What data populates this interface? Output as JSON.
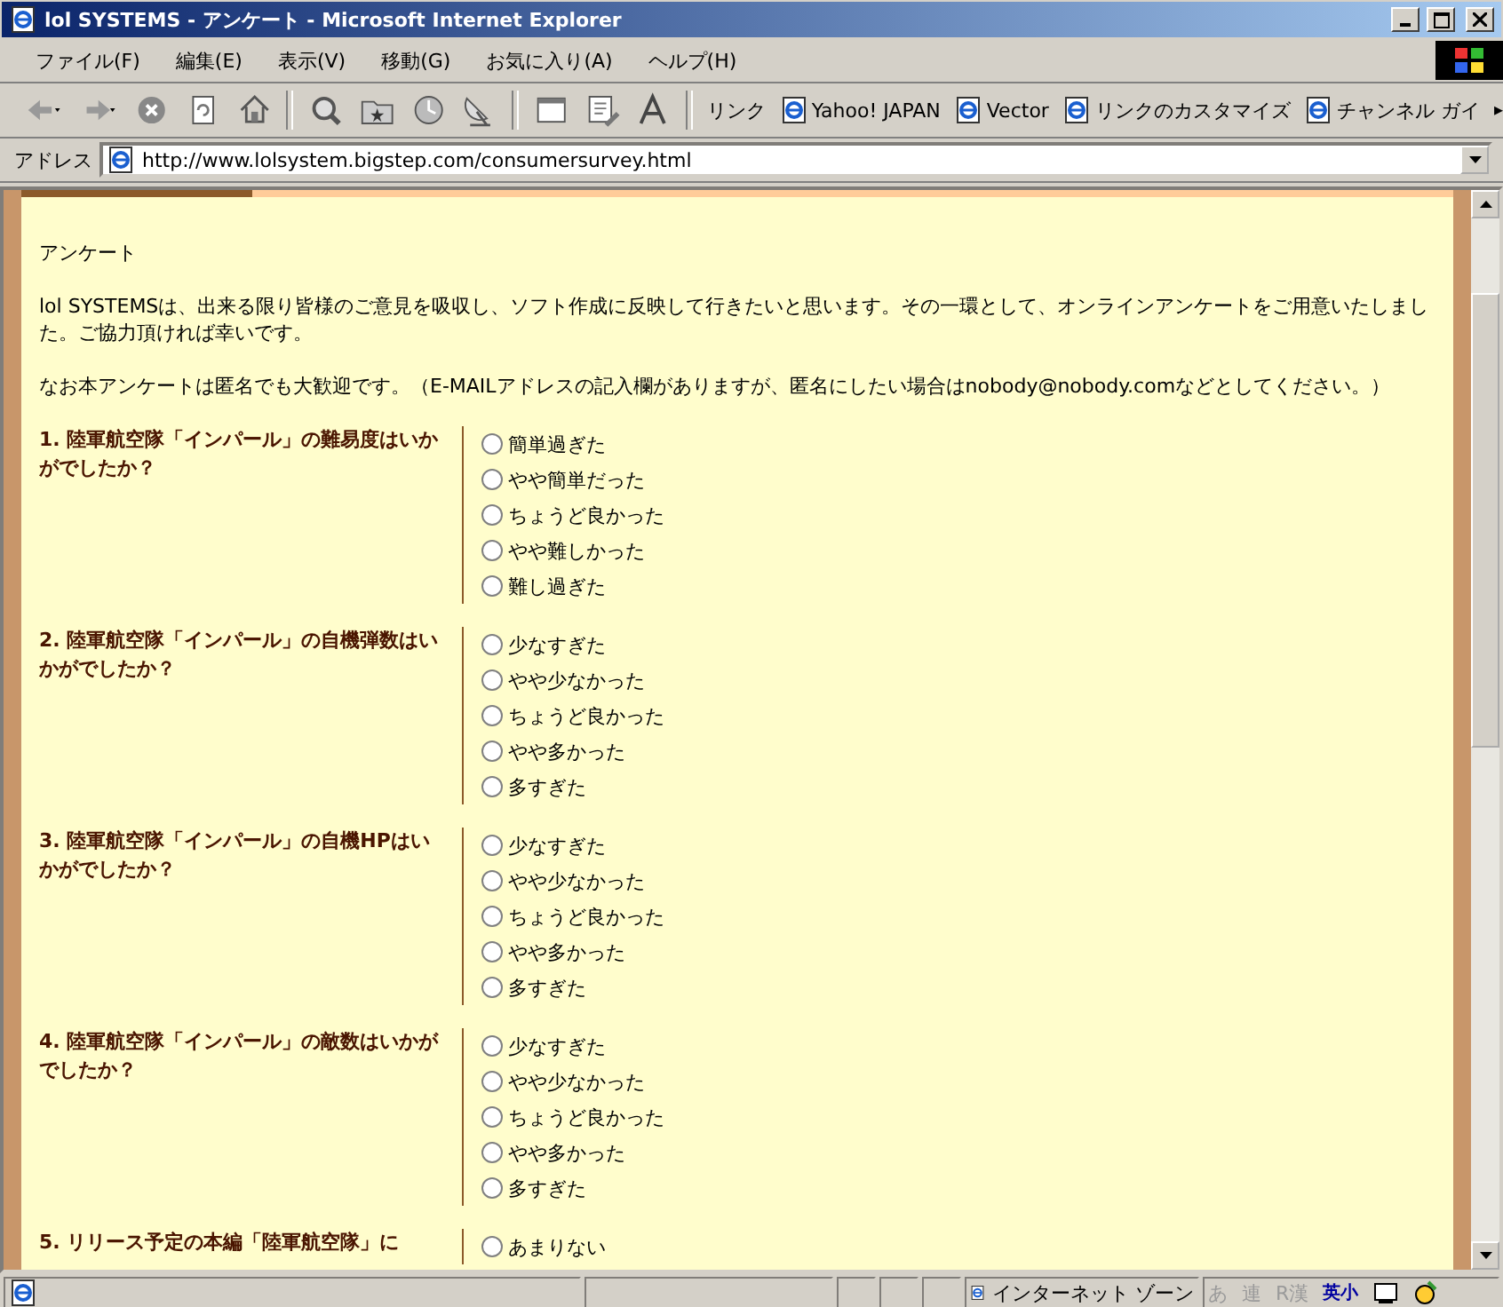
{
  "window": {
    "title": "lol SYSTEMS - アンケート - Microsoft Internet Explorer"
  },
  "menu": [
    "ファイル(F)",
    "編集(E)",
    "表示(V)",
    "移動(G)",
    "お気に入り(A)",
    "ヘルプ(H)"
  ],
  "links": {
    "label": "リンク",
    "items": [
      "Yahoo!  JAPAN",
      "Vector",
      "リンクのカスタマイズ",
      "チャンネル ガイ"
    ],
    "more": "▸"
  },
  "address": {
    "label": "アドレス",
    "value": "http://www.lolsystem.bigstep.com/consumersurvey.html"
  },
  "page": {
    "heading": "アンケート",
    "intro": "lol SYSTEMSは、出来る限り皆様のご意見を吸収し、ソフト作成に反映して行きたいと思います。その一環として、オンラインアンケートをご用意いたしました。ご協力頂ければ幸いです。",
    "note": "なお本アンケートは匿名でも大歓迎です。（E-MAILアドレスの記入欄がありますが、匿名にしたい場合はnobody@nobody.comなどとしてください。）",
    "questions": [
      {
        "text": "1. 陸軍航空隊「インパール」の難易度はいかがでしたか？",
        "options": [
          {
            "label": "簡単過ぎた",
            "selected": false
          },
          {
            "label": "やや簡単だった",
            "selected": false
          },
          {
            "label": "ちょうど良かった",
            "selected": false
          },
          {
            "label": "やや難しかった",
            "selected": false
          },
          {
            "label": "難し過ぎた",
            "selected": false
          }
        ]
      },
      {
        "text": "2. 陸軍航空隊「インパール」の自機弾数はいかがでしたか？",
        "options": [
          {
            "label": "少なすぎた",
            "selected": false
          },
          {
            "label": "やや少なかった",
            "selected": false
          },
          {
            "label": "ちょうど良かった",
            "selected": false
          },
          {
            "label": "やや多かった",
            "selected": false
          },
          {
            "label": "多すぎた",
            "selected": false
          }
        ]
      },
      {
        "text": "3. 陸軍航空隊「インパール」の自機HPはいかがでしたか？",
        "options": [
          {
            "label": "少なすぎた",
            "selected": false
          },
          {
            "label": "やや少なかった",
            "selected": false
          },
          {
            "label": "ちょうど良かった",
            "selected": false
          },
          {
            "label": "やや多かった",
            "selected": false
          },
          {
            "label": "多すぎた",
            "selected": false
          }
        ]
      },
      {
        "text": "4. 陸軍航空隊「インパール」の敵数はいかがでしたか？",
        "options": [
          {
            "label": "少なすぎた",
            "selected": false
          },
          {
            "label": "やや少なかった",
            "selected": false
          },
          {
            "label": "ちょうど良かった",
            "selected": false
          },
          {
            "label": "やや多かった",
            "selected": false
          },
          {
            "label": "多すぎた",
            "selected": false
          }
        ]
      },
      {
        "text": "5. リリース予定の本編「陸軍航空隊」に",
        "options": [
          {
            "label": "あまりない",
            "selected": false
          }
        ]
      }
    ]
  },
  "status_bar": {
    "zone": "インターネット ゾーン",
    "ime": [
      {
        "label": "あ",
        "disabled": true
      },
      {
        "label": "連",
        "disabled": true
      },
      {
        "label": "R漢",
        "disabled": true
      },
      {
        "label": "英小",
        "disabled": false
      }
    ]
  }
}
